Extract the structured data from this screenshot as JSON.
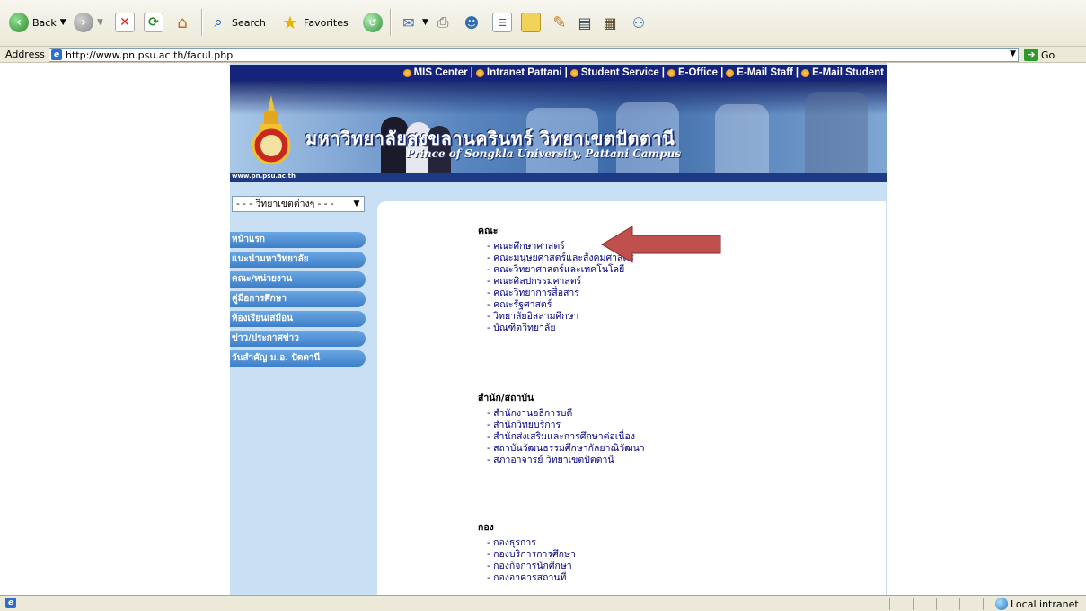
{
  "toolbar": {
    "back_label": "Back",
    "search_label": "Search",
    "favorites_label": "Favorites"
  },
  "address": {
    "label": "Address",
    "url": "http://www.pn.psu.ac.th/facul.php",
    "go_label": "Go"
  },
  "site": {
    "topnav": [
      {
        "label": "MIS Center"
      },
      {
        "label": "Intranet Pattani"
      },
      {
        "label": "Student Service"
      },
      {
        "label": "E-Office"
      },
      {
        "label": "E-Mail Staff"
      },
      {
        "label": "E-Mail Student"
      }
    ],
    "banner": {
      "thai_title": "มหาวิทยาลัยสงขลานครินทร์ วิทยาเขตปัตตานี",
      "eng_title": "Prince of Songkla University, Pattani Campus",
      "url": "www.pn.psu.ac.th"
    },
    "campus_select": "- - - วิทยาเขตต่างๆ - - -",
    "menu": [
      {
        "label": "หน้าแรก"
      },
      {
        "label": "แนะนำมหาวิทยาลัย"
      },
      {
        "label": "คณะ/หน่วยงาน"
      },
      {
        "label": "คู่มือการศึกษา"
      },
      {
        "label": "ห้องเรียนเสมือน"
      },
      {
        "label": "ข่าว/ประกาศข่าว"
      },
      {
        "label": "วันสำคัญ ม.อ. ปัตตานี"
      }
    ],
    "sections": [
      {
        "heading": "คณะ",
        "links": [
          {
            "label": "- คณะศึกษาศาสตร์"
          },
          {
            "label": "- คณะมนุษยศาสตร์และสังคมศาสตร์"
          },
          {
            "label": "- คณะวิทยาศาสตร์และเทคโนโลยี"
          },
          {
            "label": "- คณะศิลปกรรมศาสตร์"
          },
          {
            "label": "- คณะวิทยาการสื่อสาร"
          },
          {
            "label": "- คณะรัฐศาสตร์"
          },
          {
            "label": "- วิทยาลัยอิสลามศึกษา"
          },
          {
            "label": "- บัณฑิตวิทยาลัย"
          }
        ]
      },
      {
        "heading": "สำนัก/สถาบัน",
        "links": [
          {
            "label": "- สำนักงานอธิการบดี"
          },
          {
            "label": "- สำนักวิทยบริการ"
          },
          {
            "label": "- สำนักส่งเสริมและการศึกษาต่อเนื่อง"
          },
          {
            "label": "- สถาบันวัฒนธรรมศึกษากัลยาณิวัฒนา"
          },
          {
            "label": "- สภาอาจารย์ วิทยาเขตปัตตานี"
          }
        ]
      },
      {
        "heading": "กอง",
        "links": [
          {
            "label": "- กองธุรการ"
          },
          {
            "label": "- กองบริการการศึกษา"
          },
          {
            "label": "- กองกิจการนักศึกษา"
          },
          {
            "label": "- กองอาคารสถานที่"
          }
        ]
      }
    ]
  },
  "status": {
    "zone": "Local intranet"
  },
  "colors": {
    "nav_bg": "#16237a",
    "menu_button": "#4a8cd4",
    "link": "#000080",
    "arrow": "#c0504d"
  }
}
